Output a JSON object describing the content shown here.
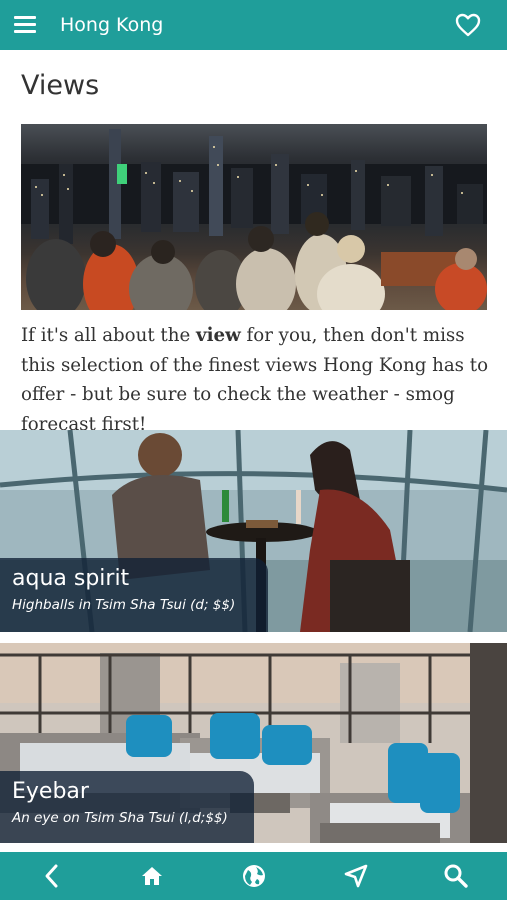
{
  "header": {
    "title": "Hong Kong",
    "menu_icon": "hamburger-menu-icon",
    "favorite_icon": "heart-outline-icon",
    "bar_color": "#1f9e9a"
  },
  "section": {
    "title": "Views",
    "hero_image": "Crowd on viewing deck overlooking Hong Kong skyline at night",
    "intro_before": "If it's all about the ",
    "intro_bold": "view",
    "intro_after": " for you, then don't miss this selection of the finest views Hong Kong has to offer - but be sure to check the weather - smog forecast first!"
  },
  "cards": [
    {
      "title": "aqua spirit",
      "subtitle": "Highballs in Tsim Sha Tsui (d; $$)"
    },
    {
      "title": "Eyebar",
      "subtitle": "An eye on Tsim Sha Tsui (l,d;$$)"
    }
  ],
  "bottom_nav": {
    "items": [
      "back-chevron-icon",
      "home-icon",
      "globe-icon",
      "navigation-arrow-icon",
      "search-icon"
    ]
  }
}
